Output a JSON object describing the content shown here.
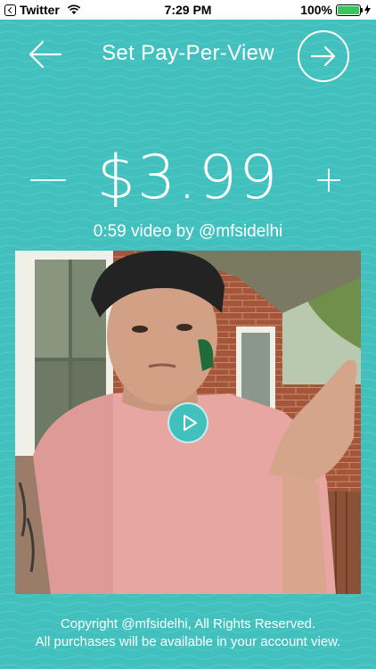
{
  "status_bar": {
    "back_app": "Twitter",
    "time": "7:29 PM",
    "battery": "100%",
    "battery_level": 1.0
  },
  "nav": {
    "title": "Set Pay-Per-View",
    "back_icon": "arrow-left-icon",
    "forward_icon": "arrow-right-icon"
  },
  "price": {
    "value": "$3.99",
    "decrement_icon": "minus-icon",
    "increment_icon": "plus-icon"
  },
  "video": {
    "caption": "0:59 video by @mfsidelhi",
    "play_icon": "play-icon"
  },
  "footer": {
    "line1": "Copyright @mfsidelhi, All Rights Reserved.",
    "line2": "All purchases will be available in your account view."
  },
  "colors": {
    "background": "#42c0bd",
    "text": "#ffffff",
    "battery": "#35c759"
  }
}
